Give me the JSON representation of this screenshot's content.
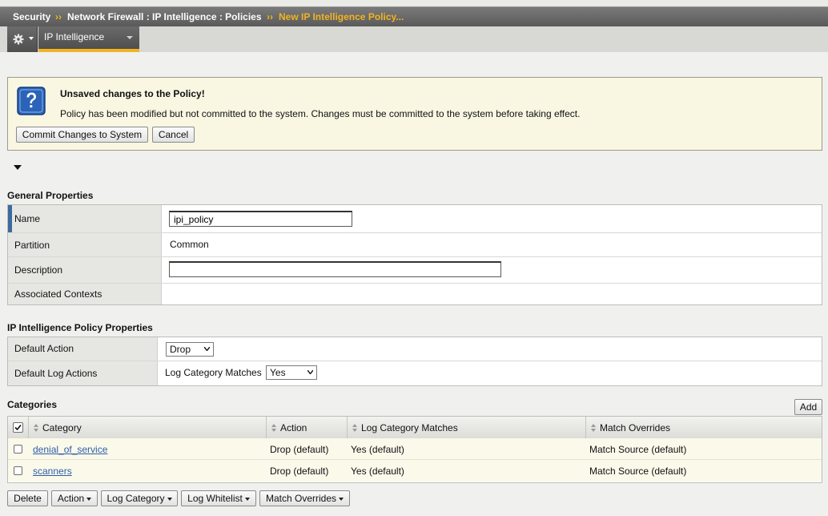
{
  "breadcrumb": {
    "items": [
      "Security",
      "Network Firewall : IP Intelligence : Policies",
      "New IP Intelligence Policy..."
    ],
    "separator": "››"
  },
  "tabs": {
    "gear_icon": "gear-icon",
    "active_tab": "IP Intelligence"
  },
  "alert": {
    "icon": "question-icon",
    "title": "Unsaved changes to the Policy!",
    "message": "Policy has been modified but not committed to the system. Changes must be committed to the system before taking effect.",
    "commit_label": "Commit Changes to System",
    "cancel_label": "Cancel"
  },
  "general": {
    "title": "General Properties",
    "name_label": "Name",
    "name_value": "ipi_policy",
    "partition_label": "Partition",
    "partition_value": "Common",
    "description_label": "Description",
    "description_value": "",
    "contexts_label": "Associated Contexts"
  },
  "ipi": {
    "title": "IP Intelligence Policy Properties",
    "default_action_label": "Default Action",
    "default_action_value": "Drop",
    "default_log_label": "Default Log Actions",
    "log_category_label": "Log Category Matches",
    "log_category_value": "Yes"
  },
  "categories": {
    "title": "Categories",
    "add_label": "Add",
    "columns": [
      "Category",
      "Action",
      "Log Category Matches",
      "Match Overrides"
    ],
    "rows": [
      {
        "category": "denial_of_service",
        "action": "Drop (default)",
        "log": "Yes (default)",
        "override": "Match Source (default)"
      },
      {
        "category": "scanners",
        "action": "Drop (default)",
        "log": "Yes (default)",
        "override": "Match Source (default)"
      }
    ]
  },
  "footer_buttons": {
    "delete": "Delete",
    "action": "Action",
    "log_category": "Log Category",
    "log_whitelist": "Log Whitelist",
    "match_overrides": "Match Overrides"
  },
  "colors": {
    "accent": "#f2b322",
    "link": "#2d5ea8",
    "alert_bg": "#f9f6e2",
    "required_marker": "#3d6a9c"
  }
}
